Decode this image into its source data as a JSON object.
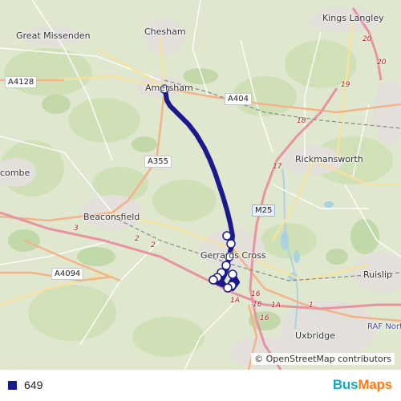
{
  "map": {
    "places": [
      {
        "id": "kings-langley",
        "label": "Kings Langley"
      },
      {
        "id": "great-missenden",
        "label": "Great Missenden"
      },
      {
        "id": "chesham",
        "label": "Chesham"
      },
      {
        "id": "amersham",
        "label": "Amersham"
      },
      {
        "id": "rickmansworth",
        "label": "Rickmansworth"
      },
      {
        "id": "beaconsfield",
        "label": "Beaconsfield"
      },
      {
        "id": "gerrards-cross",
        "label": "Gerrards Cross"
      },
      {
        "id": "ruislip",
        "label": "Ruislip"
      },
      {
        "id": "uxbridge",
        "label": "Uxbridge"
      },
      {
        "id": "combe",
        "label": "combe"
      },
      {
        "id": "raf-northolt",
        "label": "RAF North"
      }
    ],
    "roads": [
      {
        "id": "a4128",
        "label": "A4128"
      },
      {
        "id": "a404",
        "label": "A404"
      },
      {
        "id": "a355",
        "label": "A355"
      },
      {
        "id": "m25",
        "label": "M25"
      },
      {
        "id": "a4094",
        "label": "A4094"
      }
    ],
    "junctions": [
      "20",
      "19",
      "18",
      "17",
      "16",
      "1A",
      "16",
      "16",
      "1A",
      "1",
      "3",
      "2",
      "2",
      "1A",
      "16",
      "20"
    ],
    "attribution": "© OpenStreetMap contributors"
  },
  "route": {
    "name": "649",
    "color": "#1a1a8c",
    "stop_count": 11
  },
  "brand": {
    "part1": "Bus",
    "part2": "Maps"
  }
}
